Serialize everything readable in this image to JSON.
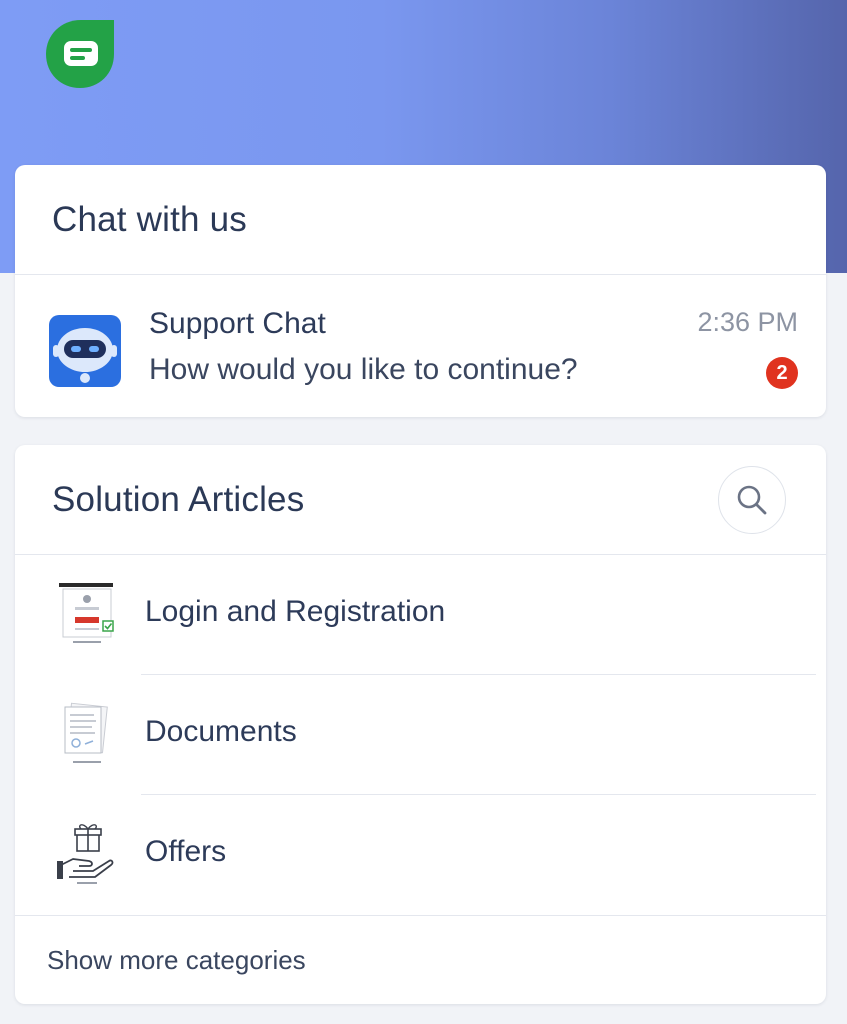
{
  "header": {
    "logo_icon": "chat-bubble-icon",
    "logo_color": "#23a247",
    "gradient_start": "#7e9cf5",
    "gradient_end": "#5565ac"
  },
  "chat": {
    "title": "Chat with us",
    "conversation": {
      "name": "Support Chat",
      "message": "How would you like to continue?",
      "time": "2:36 PM",
      "unread_count": "2",
      "avatar_icon": "robot-icon",
      "badge_color": "#e0331f"
    }
  },
  "articles": {
    "title": "Solution Articles",
    "search_icon": "search-icon",
    "categories": [
      {
        "label": "Login and Registration",
        "icon": "login-form-icon"
      },
      {
        "label": "Documents",
        "icon": "document-icon"
      },
      {
        "label": "Offers",
        "icon": "gift-hand-icon"
      }
    ],
    "show_more_label": "Show more categories"
  }
}
